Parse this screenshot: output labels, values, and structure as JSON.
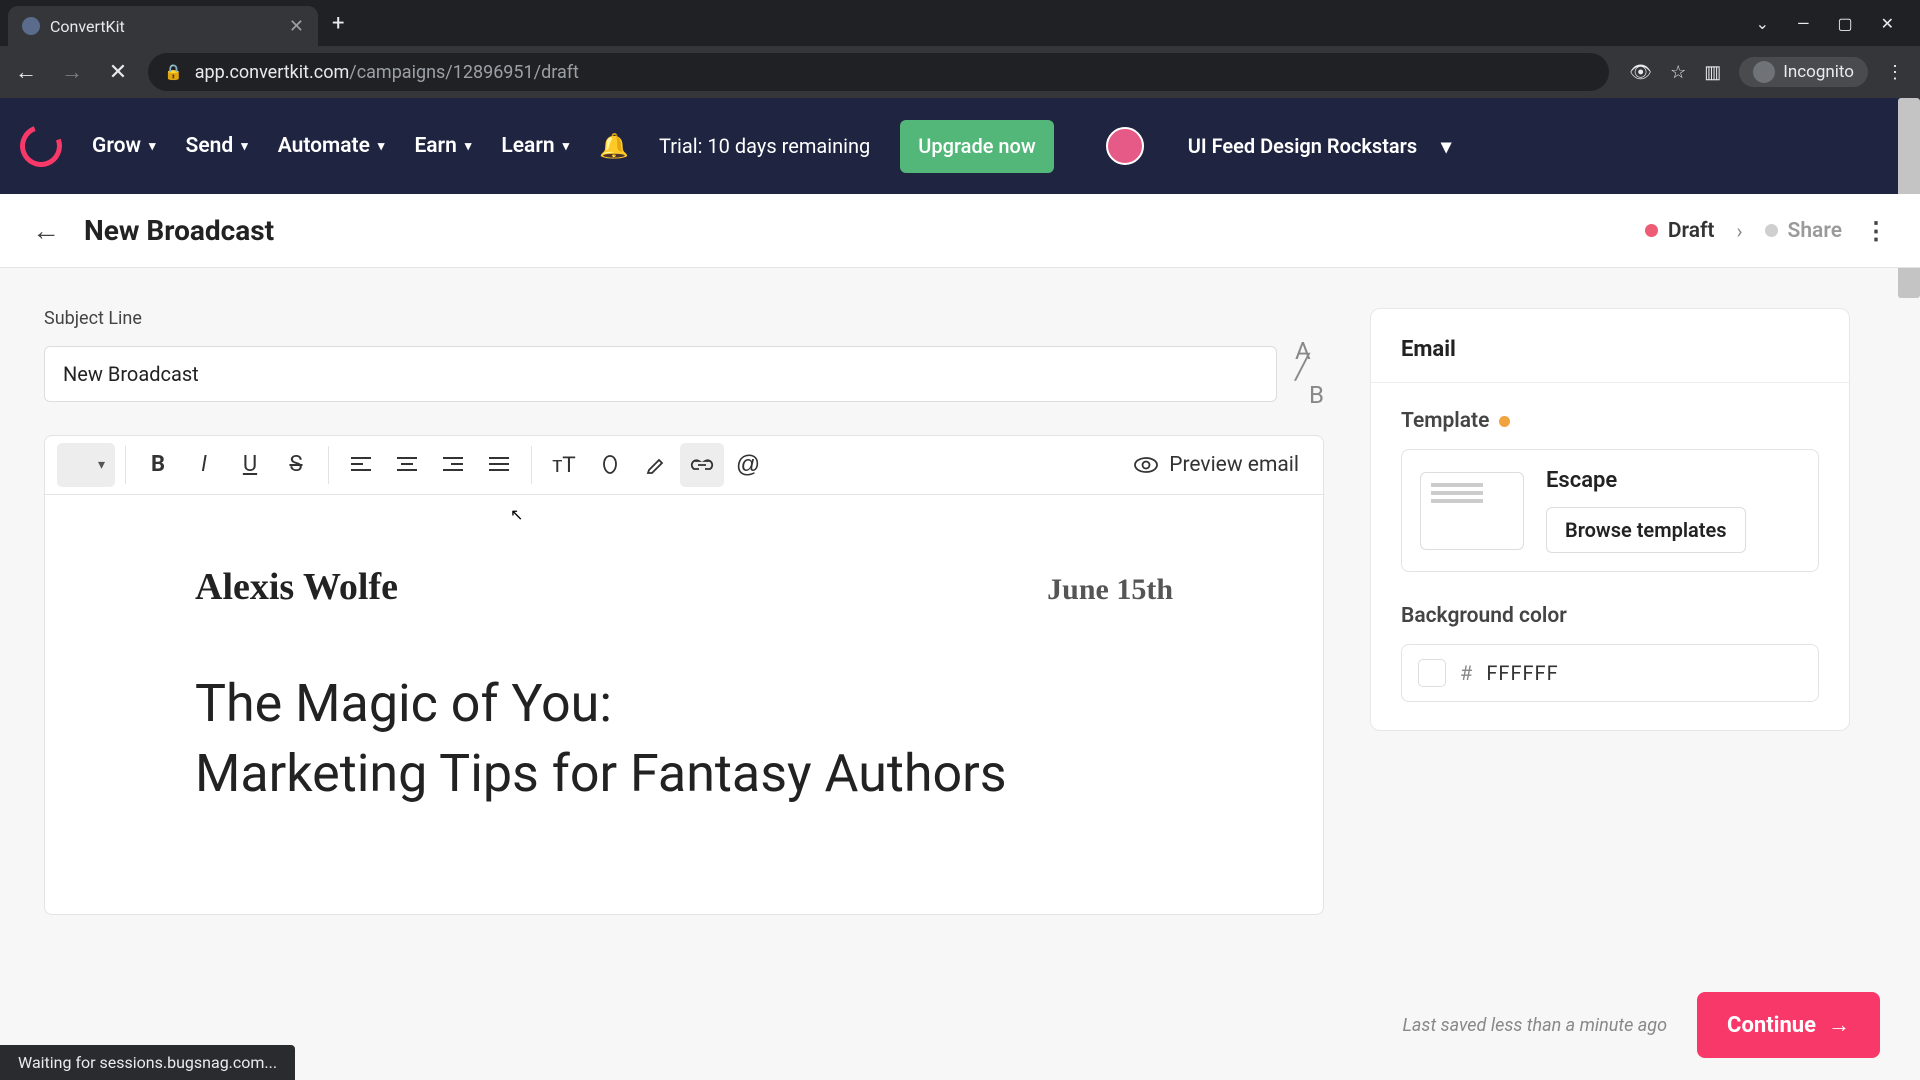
{
  "browser": {
    "tab_title": "ConvertKit",
    "url_host": "app.convertkit.com",
    "url_path": "/campaigns/12896951/draft",
    "incognito_label": "Incognito",
    "status_text": "Waiting for sessions.bugsnag.com..."
  },
  "header": {
    "nav": [
      "Grow",
      "Send",
      "Automate",
      "Earn",
      "Learn"
    ],
    "trial_text": "Trial: 10 days remaining",
    "upgrade_label": "Upgrade now",
    "org_name": "UI Feed Design Rockstars"
  },
  "subheader": {
    "page_title": "New Broadcast",
    "status_draft": "Draft",
    "status_share": "Share"
  },
  "editor": {
    "subject_label": "Subject Line",
    "subject_value": "New Broadcast",
    "preview_label": "Preview email",
    "content": {
      "author": "Alexis Wolfe",
      "date": "June 15th",
      "title_line1": "The Magic of You:",
      "title_line2": "Marketing Tips for Fantasy Authors"
    }
  },
  "sidebar": {
    "panel_title": "Email",
    "template_label": "Template",
    "template_name": "Escape",
    "browse_label": "Browse templates",
    "bg_label": "Background color",
    "bg_value": "FFFFFF"
  },
  "footer": {
    "autosave": "Last saved less than a minute ago",
    "continue_label": "Continue"
  }
}
